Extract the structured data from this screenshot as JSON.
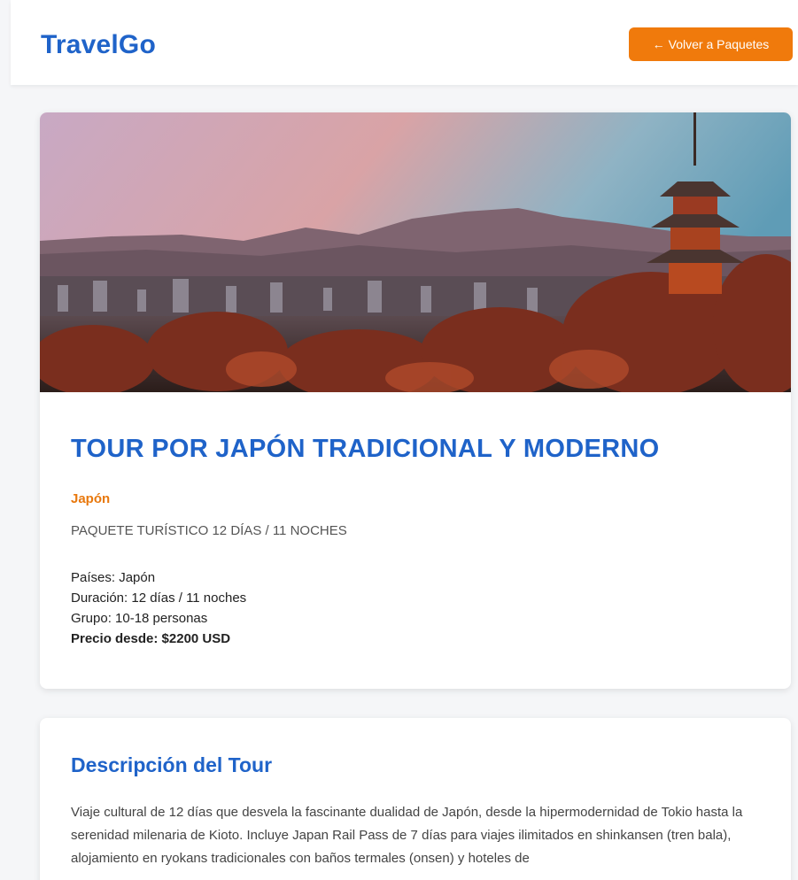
{
  "header": {
    "logo": "TravelGo",
    "back_button": {
      "arrow": "←",
      "label": "Volver a Paquetes"
    }
  },
  "tour": {
    "hero_image": "kyoto-pagoda-sunset-image",
    "title": "TOUR POR JAPÓN TRADICIONAL Y MODERNO",
    "country": "Japón",
    "subtitle": "PAQUETE TURÍSTICO 12 DÍAS / 11 NOCHES",
    "details": {
      "countries": "Países: Japón",
      "duration": "Duración: 12 días / 11 noches",
      "group": "Grupo: 10-18 personas",
      "price": "Precio desde: $2200 USD"
    }
  },
  "description": {
    "title": "Descripción del Tour",
    "text": "Viaje cultural de 12 días que desvela la fascinante dualidad de Japón, desde la hipermodernidad de Tokio hasta la serenidad milenaria de Kioto. Incluye Japan Rail Pass de 7 días para viajes ilimitados en shinkansen (tren bala), alojamiento en ryokans tradicionales con baños termales (onsen) y hoteles de"
  },
  "colors": {
    "brand_blue": "#1f63c9",
    "accent_orange": "#f07a0c",
    "country_orange": "#e8780d"
  }
}
